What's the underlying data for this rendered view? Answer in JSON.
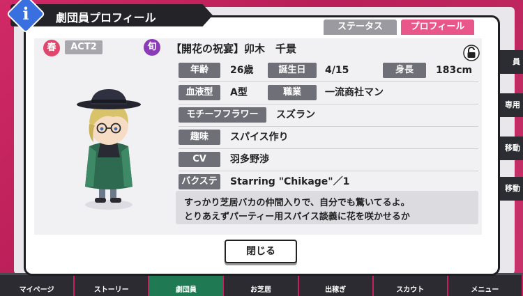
{
  "header": {
    "title": "劇団員プロフィール",
    "info_glyph": "i"
  },
  "tabs": [
    {
      "label": "ステータス"
    },
    {
      "label": "プロフィール"
    }
  ],
  "badges": {
    "season": "春",
    "act": "ACT2",
    "shun": "旬"
  },
  "character_name": "【開花の祝宴】卯木　千景",
  "profile": {
    "age": {
      "label": "年齢",
      "value": "26歳"
    },
    "birthday": {
      "label": "誕生日",
      "value": "4/15"
    },
    "height": {
      "label": "身長",
      "value": "183cm"
    },
    "blood": {
      "label": "血液型",
      "value": "A型"
    },
    "job": {
      "label": "職業",
      "value": "一流商社マン"
    },
    "flower": {
      "label": "モチーフフラワー",
      "value": "スズラン"
    },
    "hobby": {
      "label": "趣味",
      "value": "スパイス作り"
    },
    "cv": {
      "label": "CV",
      "value": "羽多野渉"
    },
    "backstage": {
      "label": "バクステ",
      "value": "Starring \"Chikage\"／1"
    }
  },
  "message": {
    "line1": "すっかり芝居バカの仲間入りで、自分でも驚いてるよ。",
    "line2": "とりあえずパーティー用スパイス談義に花を咲かせるか"
  },
  "close_label": "閉じる",
  "side_tabs": [
    "員",
    "専用",
    "移動",
    "移動"
  ],
  "nav": [
    "マイページ",
    "ストーリー",
    "劇団員",
    "お芝居",
    "出稼ぎ",
    "スカウト",
    "メニュー"
  ],
  "colors": {
    "accent": "#e8568a",
    "label_bg": "#6f6f77",
    "info": "#3a6fe0"
  }
}
